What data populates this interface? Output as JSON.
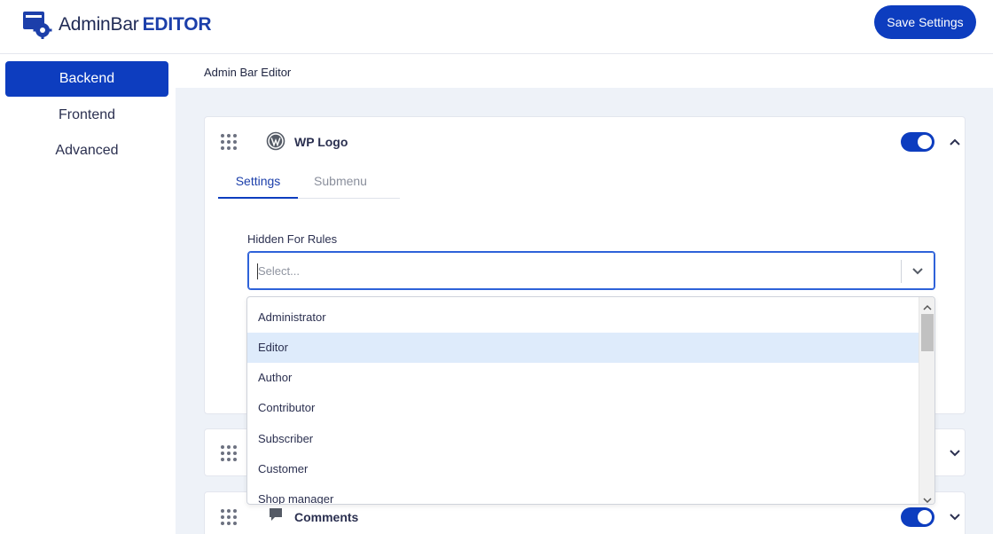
{
  "header": {
    "logo_text_1": "AdminBar",
    "logo_text_2": "EDITOR",
    "save_label": "Save Settings"
  },
  "sidebar": {
    "items": [
      {
        "label": "Backend",
        "active": true
      },
      {
        "label": "Frontend",
        "active": false
      },
      {
        "label": "Advanced",
        "active": false
      }
    ]
  },
  "main": {
    "breadcrumb": "Admin Bar Editor",
    "cards": [
      {
        "title": "WP Logo",
        "icon": "wordpress-icon",
        "enabled": true,
        "expanded": true,
        "tabs": [
          {
            "label": "Settings",
            "active": true
          },
          {
            "label": "Submenu",
            "active": false
          }
        ],
        "field_label": "Hidden For Rules",
        "select_placeholder": "Select..."
      },
      {
        "title": "",
        "enabled": true,
        "expanded": false
      },
      {
        "title": "Comments",
        "icon": "comment-icon",
        "enabled": true,
        "expanded": false
      }
    ]
  },
  "dropdown": {
    "options": [
      "Administrator",
      "Editor",
      "Author",
      "Contributor",
      "Subscriber",
      "Customer",
      "Shop manager"
    ],
    "highlighted": "Editor"
  },
  "colors": {
    "accent": "#0d3dbf",
    "highlight": "#deebfb",
    "background": "#eef2f8"
  }
}
